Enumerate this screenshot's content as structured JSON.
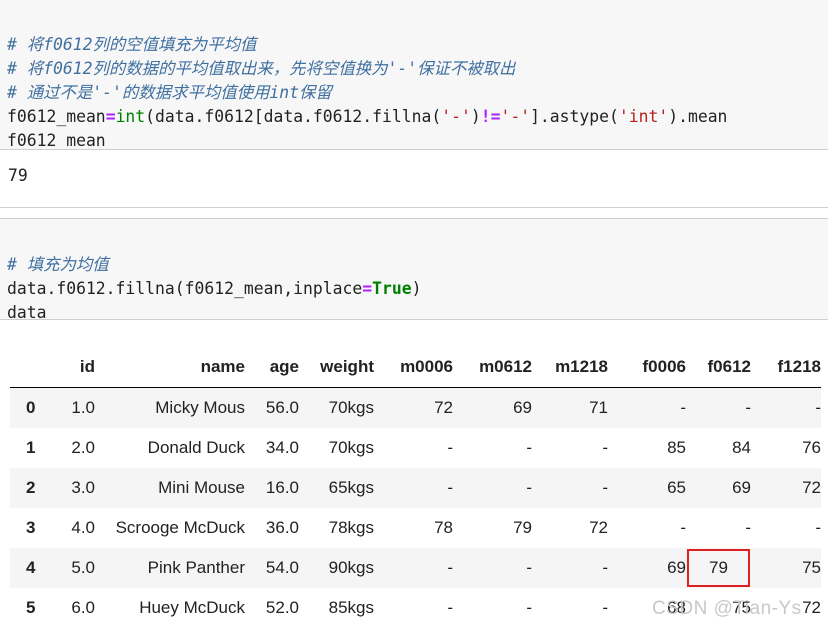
{
  "cell1": {
    "comment1": "# 将f0612列的空值填充为平均值",
    "comment2": "# 将f0612列的数据的平均值取出来，先将空值换为'-'保证不被取出",
    "comment3": "# 通过不是'-'的数据求平均值使用int保留",
    "line4": {
      "a": "f0612_mean",
      "eq": "=",
      "int": "int",
      "b": "(data.f0612[data.f0612.fillna(",
      "s1": "'-'",
      "c": ")",
      "ne": "!=",
      "s2": "'-'",
      "d": "].astype(",
      "s3": "'int'",
      "e": ").mean"
    },
    "line5": "f0612_mean"
  },
  "output1": "79",
  "cell2": {
    "comment": "# 填充为均值",
    "line2": {
      "a": "data.f0612.fillna(f0612_mean,",
      "b": "inplace",
      "eq": "=",
      "true": "True",
      "c": ")"
    },
    "line3": "data"
  },
  "table": {
    "columns": [
      "",
      "id",
      "name",
      "age",
      "weight",
      "m0006",
      "m0612",
      "m1218",
      "f0006",
      "f0612",
      "f1218"
    ],
    "rows": [
      {
        "index": "0",
        "cells": [
          "1.0",
          "Micky Mous",
          "56.0",
          "70kgs",
          "72",
          "69",
          "71",
          "-",
          "-",
          "-"
        ]
      },
      {
        "index": "1",
        "cells": [
          "2.0",
          "Donald Duck",
          "34.0",
          "70kgs",
          "-",
          "-",
          "-",
          "85",
          "84",
          "76"
        ]
      },
      {
        "index": "2",
        "cells": [
          "3.0",
          "Mini Mouse",
          "16.0",
          "65kgs",
          "-",
          "-",
          "-",
          "65",
          "69",
          "72"
        ]
      },
      {
        "index": "3",
        "cells": [
          "4.0",
          "Scrooge McDuck",
          "36.0",
          "78kgs",
          "78",
          "79",
          "72",
          "-",
          "-",
          "-"
        ]
      },
      {
        "index": "4",
        "cells": [
          "5.0",
          "Pink Panther",
          "54.0",
          "90kgs",
          "-",
          "-",
          "-",
          "69",
          "79",
          "75"
        ]
      },
      {
        "index": "5",
        "cells": [
          "6.0",
          "Huey McDuck",
          "52.0",
          "85kgs",
          "-",
          "-",
          "-",
          "68",
          "75",
          "72"
        ]
      }
    ],
    "highlight_color": "#e02020"
  },
  "watermark": "CSDN @Tian-Ys"
}
